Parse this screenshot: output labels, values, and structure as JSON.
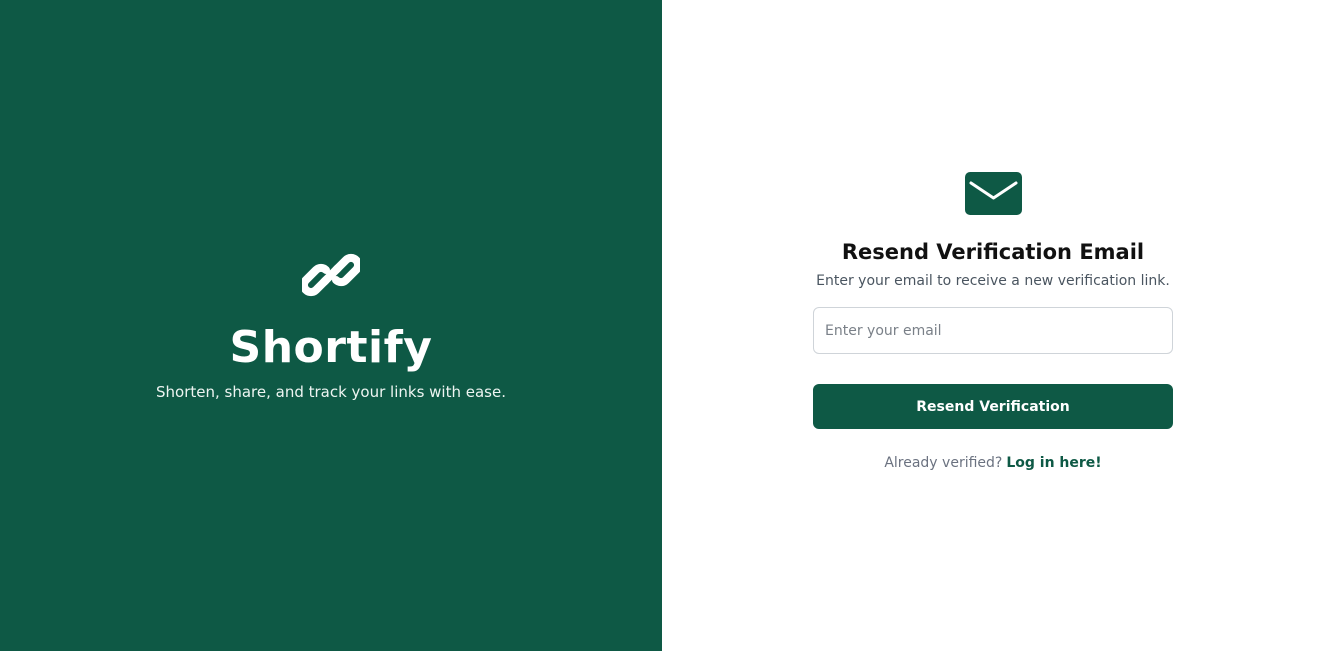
{
  "brand": {
    "icon": "link-icon",
    "name": "Shortify",
    "tagline": "Shorten, share, and track your links with ease."
  },
  "form": {
    "icon": "envelope-icon",
    "title": "Resend Verification Email",
    "subtitle": "Enter your email to receive a new verification link.",
    "email_placeholder": "Enter your email",
    "email_value": "",
    "submit_label": "Resend Verification",
    "login_prompt": "Already verified?",
    "login_link": "Log in here!"
  },
  "colors": {
    "brand_green": "#0e5945",
    "panel_text": "#ffffff",
    "background": "#ffffff"
  }
}
